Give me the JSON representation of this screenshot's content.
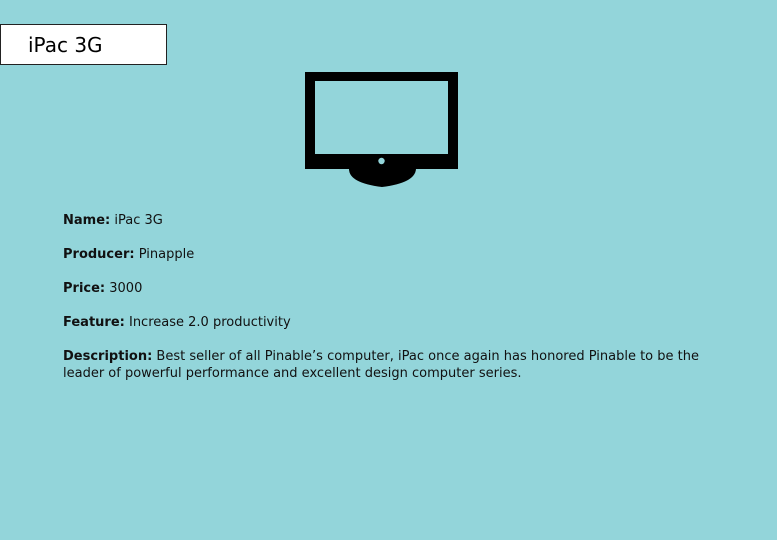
{
  "header": {
    "title": "iPac 3G"
  },
  "product": {
    "icon": "monitor-icon",
    "name_label": "Name:",
    "name": "iPac 3G",
    "producer_label": "Producer:",
    "producer": "Pinapple",
    "price_label": "Price:",
    "price": "3000",
    "feature_label": "Feature:",
    "feature": "Increase 2.0 productivity",
    "description_label": "Description:",
    "description": "Best seller of all Pinable’s computer, iPac once again has honored Pinable to be the leader of powerful performance and excellent design computer series."
  },
  "colors": {
    "background": "#93d5da",
    "title_box": "#ffffff",
    "icon": "#000000"
  }
}
